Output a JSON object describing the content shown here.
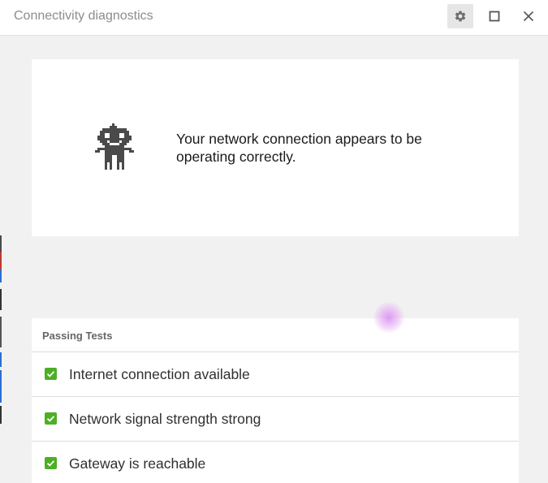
{
  "window": {
    "title": "Connectivity diagnostics"
  },
  "titlebar_buttons": {
    "settings_icon": "gear-icon",
    "maximize_icon": "maximize-icon",
    "close_icon": "close-icon"
  },
  "status": {
    "message": "Your network connection appears to be operating correctly.",
    "icon": "robot-icon"
  },
  "tests": {
    "header": "Passing Tests",
    "items": [
      {
        "label": "Internet connection available",
        "status": "passed"
      },
      {
        "label": "Network signal strength strong",
        "status": "passed"
      },
      {
        "label": "Gateway is reachable",
        "status": "passed"
      }
    ]
  },
  "colors": {
    "check": "#4caf25",
    "robot": "#4a4a4a",
    "background": "#f1f1f1"
  }
}
